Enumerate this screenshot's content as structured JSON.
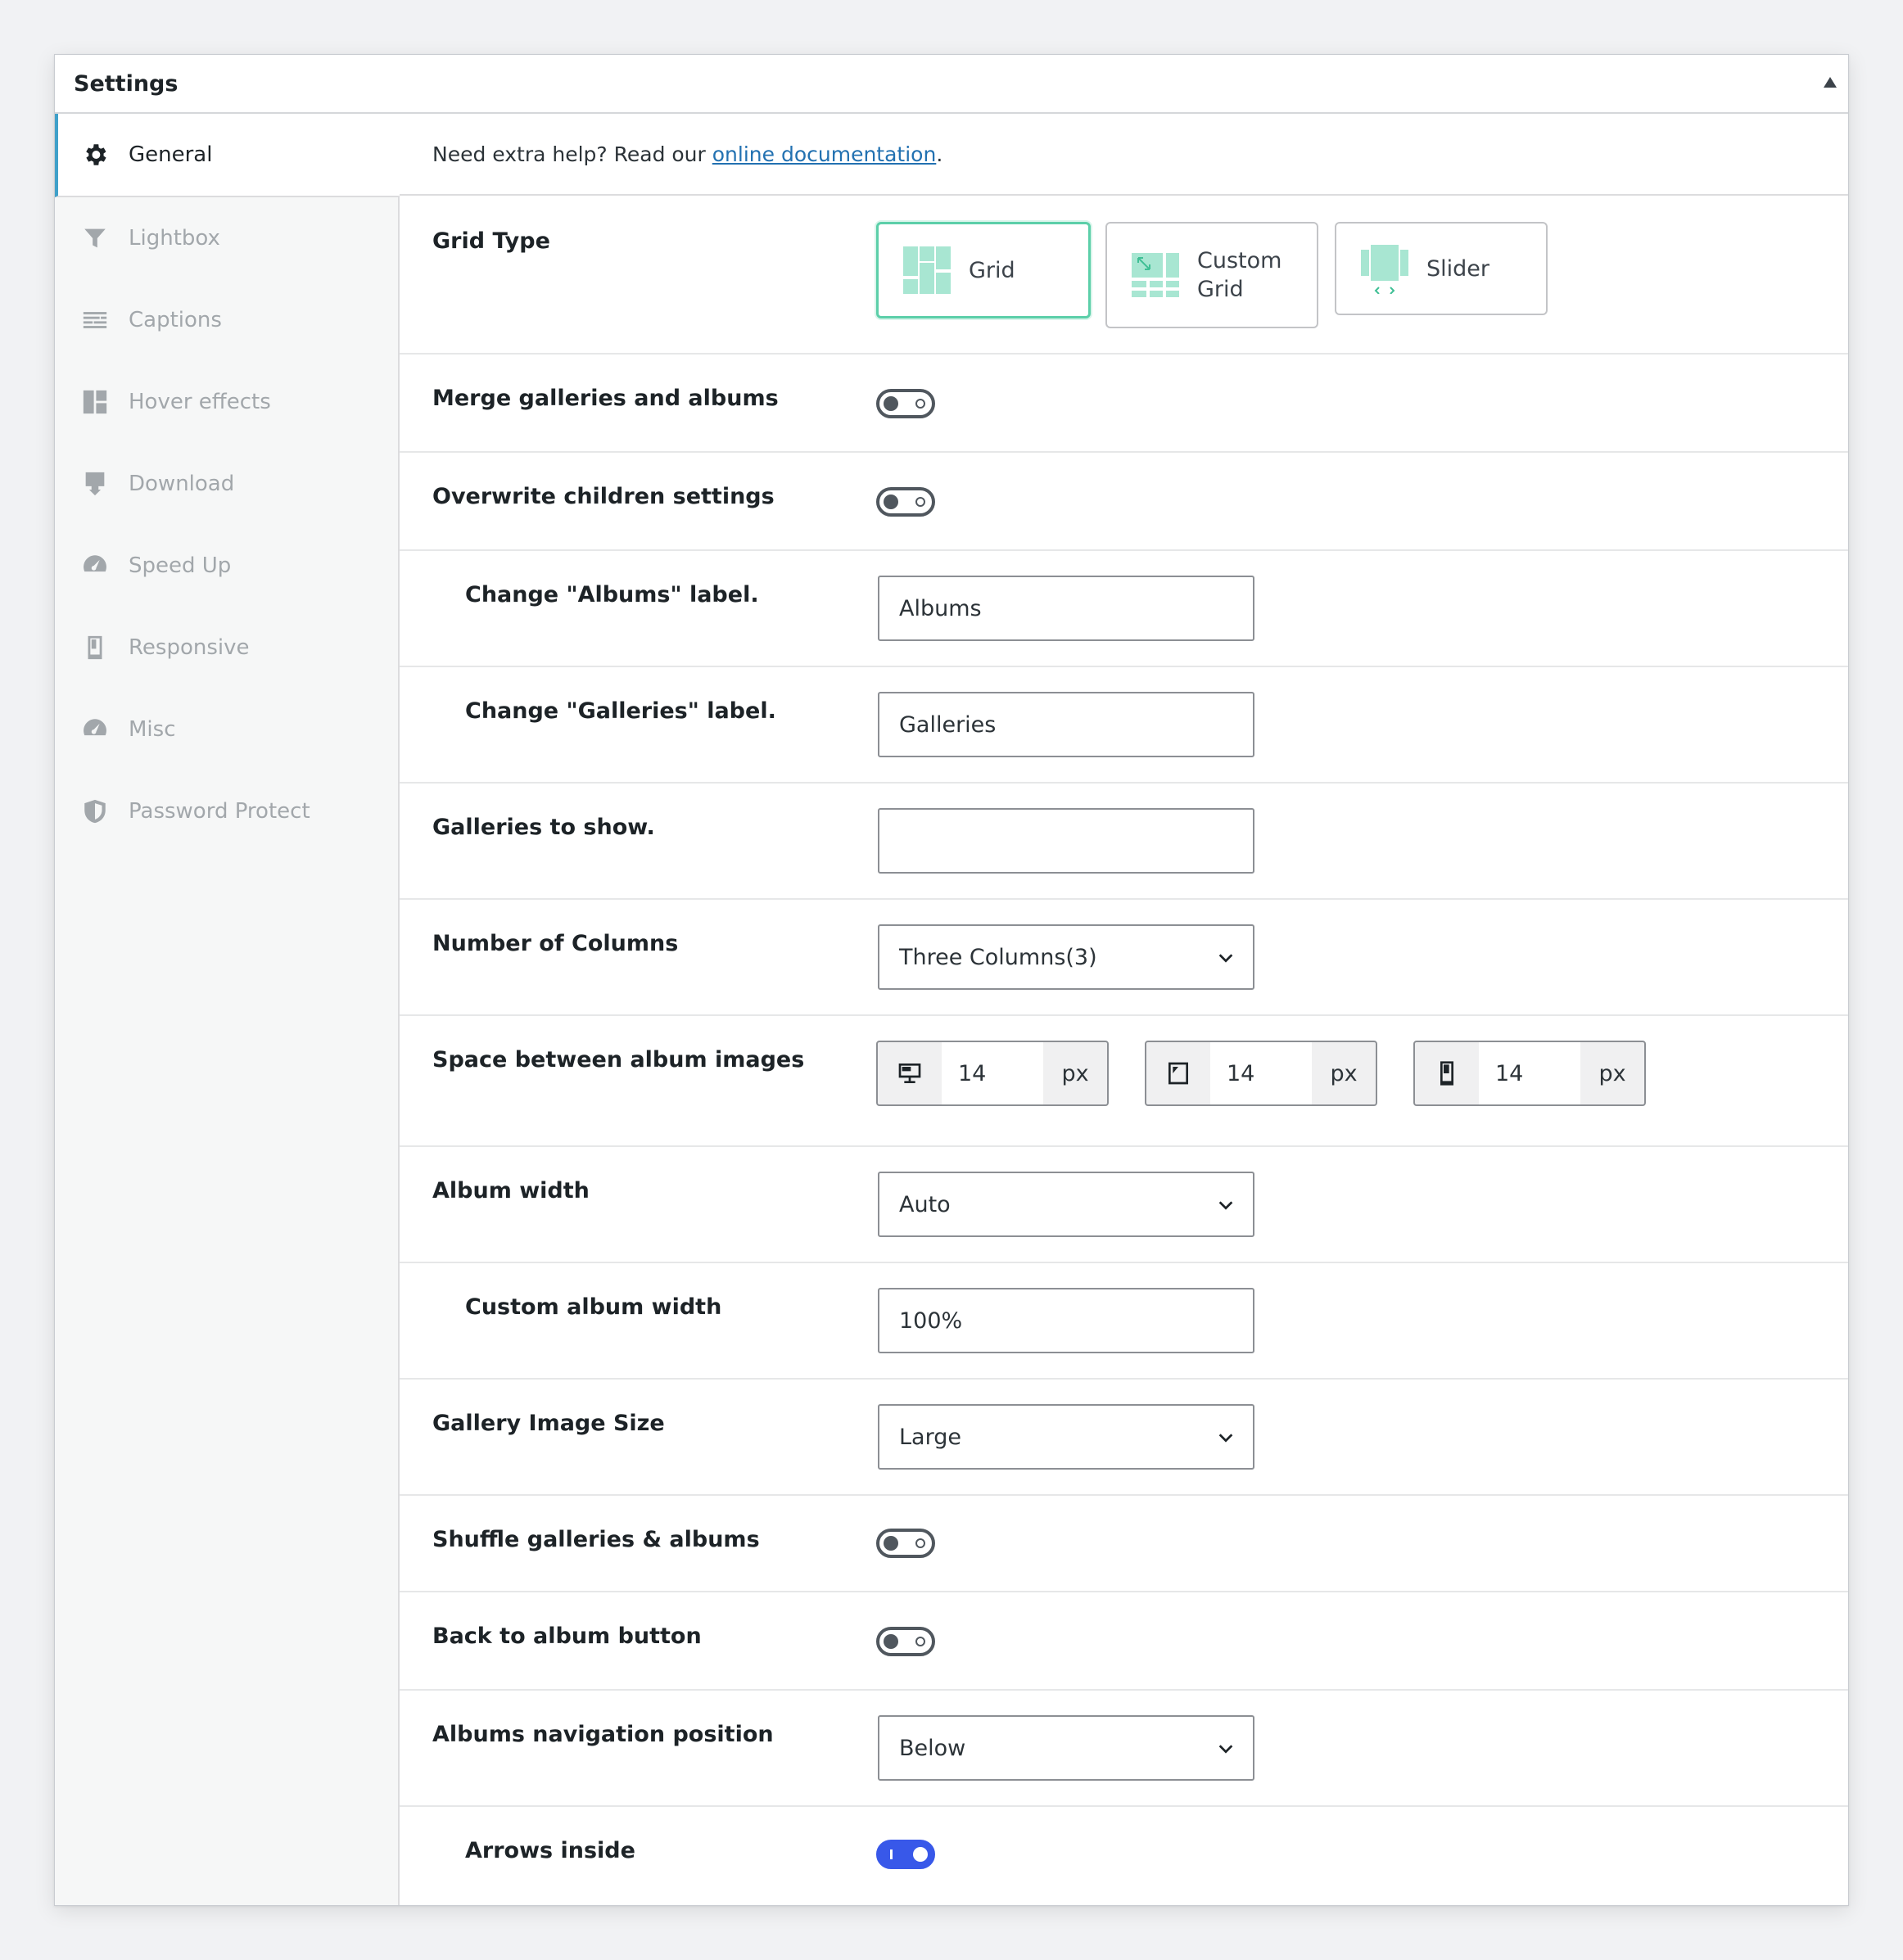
{
  "panel": {
    "title": "Settings"
  },
  "sidebar": {
    "items": [
      {
        "label": "General",
        "icon": "gear-icon",
        "active": true
      },
      {
        "label": "Lightbox",
        "icon": "funnel-icon"
      },
      {
        "label": "Captions",
        "icon": "captions-icon"
      },
      {
        "label": "Hover effects",
        "icon": "hover-grid-icon"
      },
      {
        "label": "Download",
        "icon": "download-icon"
      },
      {
        "label": "Speed Up",
        "icon": "dashboard-icon"
      },
      {
        "label": "Responsive",
        "icon": "phone-icon"
      },
      {
        "label": "Misc",
        "icon": "dashboard-icon"
      },
      {
        "label": "Password Protect",
        "icon": "shield-icon"
      }
    ]
  },
  "help": {
    "prefix": "Need extra help? Read our ",
    "link": "online documentation",
    "suffix": "."
  },
  "rows": {
    "grid_type": {
      "label": "Grid Type",
      "options": [
        {
          "label": "Grid",
          "selected": true
        },
        {
          "label": "Custom Grid"
        },
        {
          "label": "Slider"
        }
      ]
    },
    "merge": {
      "label": "Merge galleries and albums",
      "on": false
    },
    "overwrite": {
      "label": "Overwrite children settings",
      "on": false
    },
    "albums_label": {
      "label": "Change \"Albums\" label.",
      "value": "Albums"
    },
    "galleries_label": {
      "label": "Change \"Galleries\" label.",
      "value": "Galleries"
    },
    "galleries_to_show": {
      "label": "Galleries to show.",
      "value": ""
    },
    "columns": {
      "label": "Number of Columns",
      "value": "Three Columns(3)"
    },
    "spacing": {
      "label": "Space between album images",
      "devices": [
        {
          "icon": "desktop-icon",
          "value": "14",
          "unit": "px"
        },
        {
          "icon": "tablet-icon",
          "value": "14",
          "unit": "px"
        },
        {
          "icon": "mobile-icon",
          "value": "14",
          "unit": "px"
        }
      ]
    },
    "album_width": {
      "label": "Album width",
      "value": "Auto"
    },
    "custom_width": {
      "label": "Custom album width",
      "value": "100%"
    },
    "image_size": {
      "label": "Gallery Image Size",
      "value": "Large"
    },
    "shuffle": {
      "label": "Shuffle galleries & albums",
      "on": false
    },
    "back_button": {
      "label": "Back to album button",
      "on": false
    },
    "nav_position": {
      "label": "Albums navigation position",
      "value": "Below"
    },
    "arrows_inside": {
      "label": "Arrows inside",
      "on": true
    }
  },
  "colors": {
    "accent_toggle": "#3858e9",
    "selected_card": "#5ccfa9",
    "active_tab_border": "#3fa0c9",
    "link": "#2271b1"
  }
}
